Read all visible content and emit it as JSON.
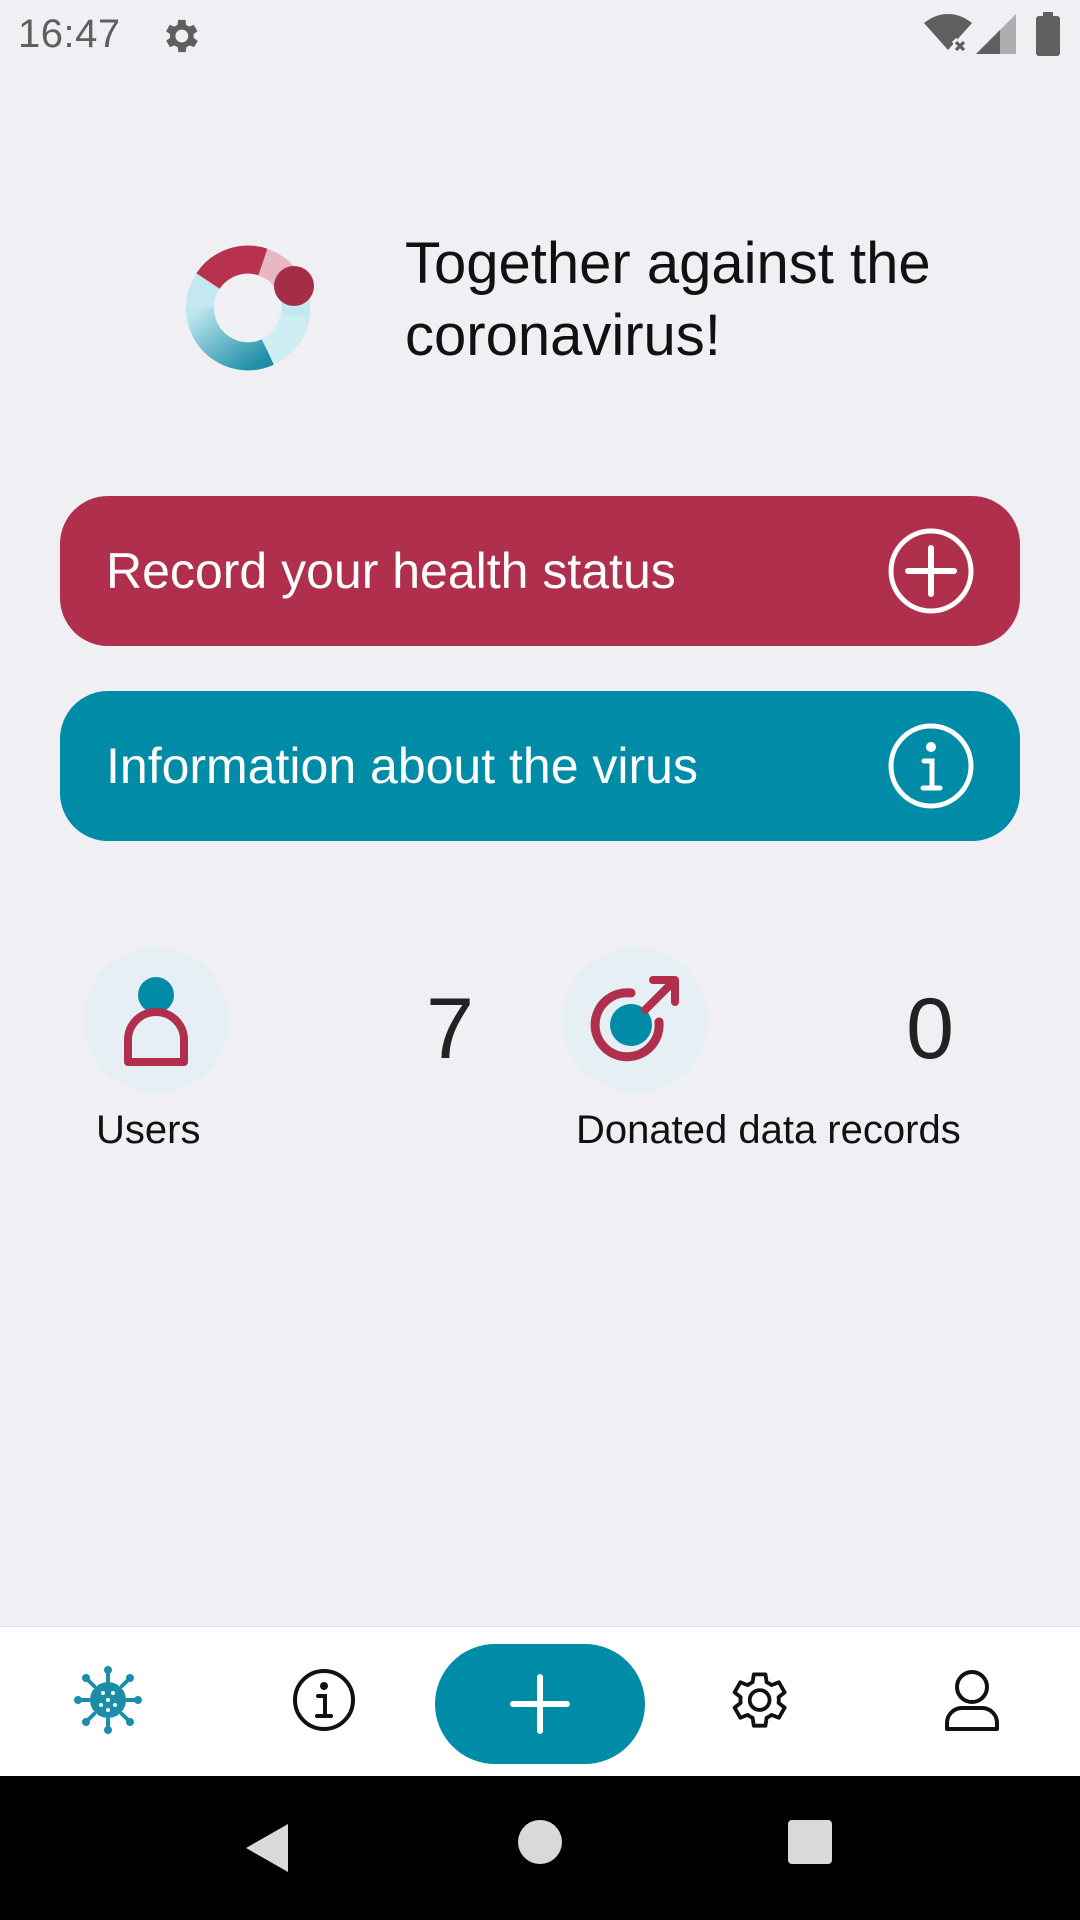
{
  "status_bar": {
    "time": "16:47",
    "icons": [
      "gear-icon",
      "wifi-off-icon",
      "signal-icon",
      "battery-icon"
    ]
  },
  "hero": {
    "title": "Together against the coronavirus!",
    "logo": "app-logo-ring"
  },
  "actions": {
    "record": {
      "label": "Record your health status",
      "icon": "plus-circle-icon"
    },
    "info": {
      "label": "Information about the virus",
      "icon": "info-circle-icon"
    }
  },
  "stats": {
    "users": {
      "label": "Users",
      "value": "7",
      "icon": "user-icon"
    },
    "donated": {
      "label": "Donated data records",
      "value": "0",
      "icon": "share-data-icon"
    }
  },
  "bottom_nav": {
    "items": [
      {
        "id": "home",
        "icon": "virus-icon",
        "active": true
      },
      {
        "id": "info",
        "icon": "info-icon"
      },
      {
        "id": "add",
        "icon": "plus-icon"
      },
      {
        "id": "settings",
        "icon": "gear-icon"
      },
      {
        "id": "profile",
        "icon": "person-icon"
      }
    ]
  },
  "colors": {
    "primary_red": "#b02f4c",
    "primary_teal": "#008ba6",
    "background": "#efeff4"
  }
}
